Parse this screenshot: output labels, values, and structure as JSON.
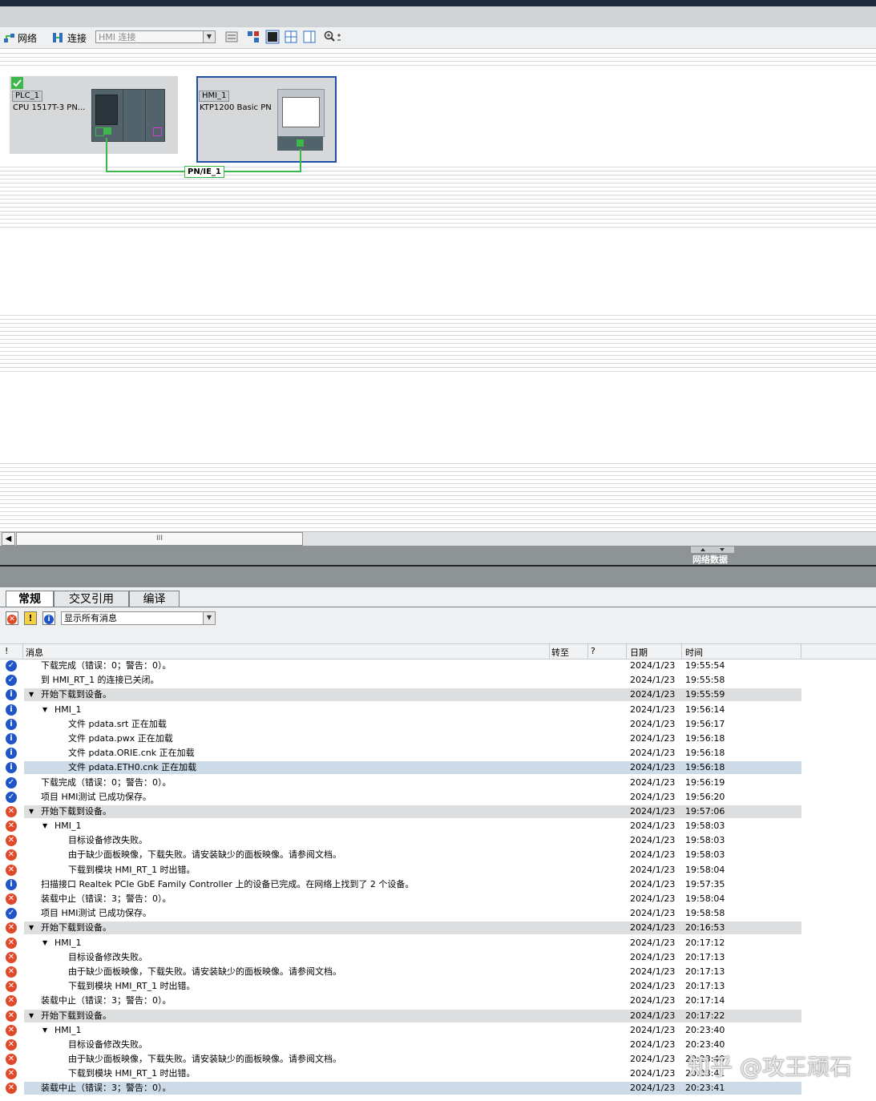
{
  "toolbar": {
    "network_label": "网络",
    "connect_label": "连接",
    "connection_combo": "HMI 连接"
  },
  "devices": {
    "plc_name": "PLC_1",
    "plc_type": "CPU 1517T-3 PN...",
    "hmi_name": "HMI_1",
    "hmi_type": "KTP1200 Basic PN",
    "subnet": "PN/IE_1"
  },
  "scrollbar": {
    "thumb_glyph": "III"
  },
  "panel": {
    "network_data_label": "网络数据"
  },
  "tabs": [
    "常规",
    "交叉引用",
    "编译"
  ],
  "filter": {
    "selected": "显示所有消息"
  },
  "columns": {
    "bang": "!",
    "message": "消息",
    "goto": "转至",
    "q": "?",
    "date": "日期",
    "time": "时间"
  },
  "messages": [
    {
      "icon": "ok",
      "indent": 0,
      "expand": false,
      "text": "下载完成（错误：0；警告：0）。",
      "date": "2024/1/23",
      "time": "19:55:54",
      "style": ""
    },
    {
      "icon": "ok",
      "indent": 0,
      "expand": false,
      "text": "到 HMI_RT_1 的连接已关闭。",
      "date": "2024/1/23",
      "time": "19:55:58",
      "style": ""
    },
    {
      "icon": "info",
      "indent": 0,
      "expand": true,
      "text": "开始下载到设备。",
      "date": "2024/1/23",
      "time": "19:55:59",
      "style": "shade"
    },
    {
      "icon": "info",
      "indent": 1,
      "expand": true,
      "text": "HMI_1",
      "date": "2024/1/23",
      "time": "19:56:14",
      "style": ""
    },
    {
      "icon": "info",
      "indent": 2,
      "expand": false,
      "text": "文件 pdata.srt 正在加载",
      "date": "2024/1/23",
      "time": "19:56:17",
      "style": ""
    },
    {
      "icon": "info",
      "indent": 2,
      "expand": false,
      "text": "文件 pdata.pwx 正在加载",
      "date": "2024/1/23",
      "time": "19:56:18",
      "style": ""
    },
    {
      "icon": "info",
      "indent": 2,
      "expand": false,
      "text": "文件 pdata.ORIE.cnk 正在加载",
      "date": "2024/1/23",
      "time": "19:56:18",
      "style": ""
    },
    {
      "icon": "info",
      "indent": 2,
      "expand": false,
      "text": "文件 pdata.ETH0.cnk 正在加载",
      "date": "2024/1/23",
      "time": "19:56:18",
      "style": "sel"
    },
    {
      "icon": "ok",
      "indent": 0,
      "expand": false,
      "text": "下载完成（错误：0；警告：0）。",
      "date": "2024/1/23",
      "time": "19:56:19",
      "style": ""
    },
    {
      "icon": "ok",
      "indent": 0,
      "expand": false,
      "text": "项目 HMI测试 已成功保存。",
      "date": "2024/1/23",
      "time": "19:56:20",
      "style": ""
    },
    {
      "icon": "err",
      "indent": 0,
      "expand": true,
      "text": "开始下载到设备。",
      "date": "2024/1/23",
      "time": "19:57:06",
      "style": "shade"
    },
    {
      "icon": "err",
      "indent": 1,
      "expand": true,
      "text": "HMI_1",
      "date": "2024/1/23",
      "time": "19:58:03",
      "style": ""
    },
    {
      "icon": "err",
      "indent": 2,
      "expand": false,
      "text": "目标设备修改失败。",
      "date": "2024/1/23",
      "time": "19:58:03",
      "style": ""
    },
    {
      "icon": "err",
      "indent": 2,
      "expand": false,
      "text": "由于缺少面板映像，下载失败。请安装缺少的面板映像。请参阅文档。",
      "date": "2024/1/23",
      "time": "19:58:03",
      "style": ""
    },
    {
      "icon": "err",
      "indent": 2,
      "expand": false,
      "text": "下载到模块 HMI_RT_1 时出错。",
      "date": "2024/1/23",
      "time": "19:58:04",
      "style": ""
    },
    {
      "icon": "info",
      "indent": 0,
      "expand": false,
      "text": "扫描接口 Realtek PCIe GbE Family Controller 上的设备已完成。在网络上找到了 2 个设备。",
      "date": "2024/1/23",
      "time": "19:57:35",
      "style": ""
    },
    {
      "icon": "err",
      "indent": 0,
      "expand": false,
      "text": "装载中止（错误：3；警告：0）。",
      "date": "2024/1/23",
      "time": "19:58:04",
      "style": ""
    },
    {
      "icon": "ok",
      "indent": 0,
      "expand": false,
      "text": "项目 HMI测试 已成功保存。",
      "date": "2024/1/23",
      "time": "19:58:58",
      "style": ""
    },
    {
      "icon": "err",
      "indent": 0,
      "expand": true,
      "text": "开始下载到设备。",
      "date": "2024/1/23",
      "time": "20:16:53",
      "style": "shade"
    },
    {
      "icon": "err",
      "indent": 1,
      "expand": true,
      "text": "HMI_1",
      "date": "2024/1/23",
      "time": "20:17:12",
      "style": ""
    },
    {
      "icon": "err",
      "indent": 2,
      "expand": false,
      "text": "目标设备修改失败。",
      "date": "2024/1/23",
      "time": "20:17:13",
      "style": ""
    },
    {
      "icon": "err",
      "indent": 2,
      "expand": false,
      "text": "由于缺少面板映像，下载失败。请安装缺少的面板映像。请参阅文档。",
      "date": "2024/1/23",
      "time": "20:17:13",
      "style": ""
    },
    {
      "icon": "err",
      "indent": 2,
      "expand": false,
      "text": "下载到模块 HMI_RT_1 时出错。",
      "date": "2024/1/23",
      "time": "20:17:13",
      "style": ""
    },
    {
      "icon": "err",
      "indent": 0,
      "expand": false,
      "text": "装载中止（错误：3；警告：0）。",
      "date": "2024/1/23",
      "time": "20:17:14",
      "style": ""
    },
    {
      "icon": "err",
      "indent": 0,
      "expand": true,
      "text": "开始下载到设备。",
      "date": "2024/1/23",
      "time": "20:17:22",
      "style": "shade"
    },
    {
      "icon": "err",
      "indent": 1,
      "expand": true,
      "text": "HMI_1",
      "date": "2024/1/23",
      "time": "20:23:40",
      "style": ""
    },
    {
      "icon": "err",
      "indent": 2,
      "expand": false,
      "text": "目标设备修改失败。",
      "date": "2024/1/23",
      "time": "20:23:40",
      "style": ""
    },
    {
      "icon": "err",
      "indent": 2,
      "expand": false,
      "text": "由于缺少面板映像，下载失败。请安装缺少的面板映像。请参阅文档。",
      "date": "2024/1/23",
      "time": "20:23:40",
      "style": ""
    },
    {
      "icon": "err",
      "indent": 2,
      "expand": false,
      "text": "下载到模块 HMI_RT_1 时出错。",
      "date": "2024/1/23",
      "time": "20:23:41",
      "style": ""
    },
    {
      "icon": "err",
      "indent": 0,
      "expand": false,
      "text": "装载中止（错误：3；警告：0）。",
      "date": "2024/1/23",
      "time": "20:23:41",
      "style": "sel"
    }
  ],
  "watermark": "知乎 @攻王顽石"
}
